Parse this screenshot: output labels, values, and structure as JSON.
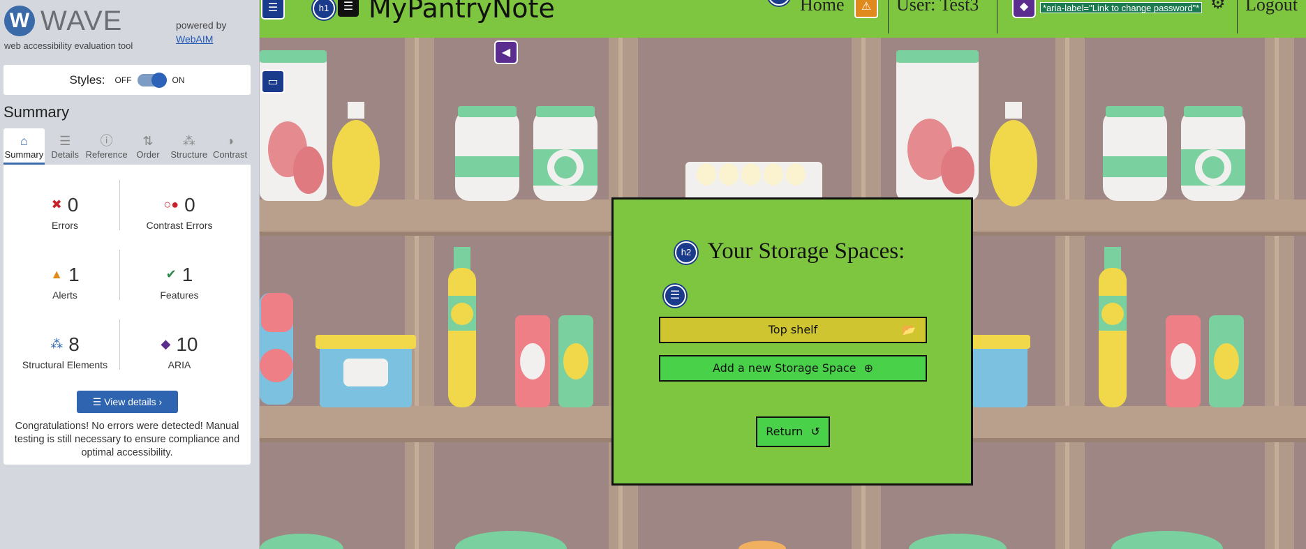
{
  "wave": {
    "logo_letter": "W",
    "logo_text": "WAVE",
    "tagline": "web accessibility evaluation tool",
    "powered_by": "powered by",
    "webaim_link": "WebAIM",
    "styles_label": "Styles:",
    "styles_off": "OFF",
    "styles_on": "ON",
    "summary_title": "Summary",
    "tabs": [
      {
        "label": "Summary",
        "icon": "home-icon",
        "glyph": "⌂",
        "active": true
      },
      {
        "label": "Details",
        "icon": "list-icon",
        "glyph": "☰",
        "active": false
      },
      {
        "label": "Reference",
        "icon": "info-icon",
        "glyph": "ⓘ",
        "active": false
      },
      {
        "label": "Order",
        "icon": "order-icon",
        "glyph": "⇅",
        "active": false
      },
      {
        "label": "Structure",
        "icon": "structure-icon",
        "glyph": "⁂",
        "active": false
      },
      {
        "label": "Contrast",
        "icon": "contrast-icon",
        "glyph": "◑",
        "active": false
      }
    ],
    "stats": {
      "errors": {
        "count": "0",
        "label": "Errors",
        "color": "#c8232c"
      },
      "contrast_errors": {
        "count": "0",
        "label": "Contrast Errors",
        "color": "#c8232c"
      },
      "alerts": {
        "count": "1",
        "label": "Alerts",
        "color": "#e08a1e"
      },
      "features": {
        "count": "1",
        "label": "Features",
        "color": "#2f8a4a"
      },
      "structural": {
        "count": "8",
        "label": "Structural Elements",
        "color": "#2f65b0"
      },
      "aria": {
        "count": "10",
        "label": "ARIA",
        "color": "#5b2d8e"
      }
    },
    "view_details": "View details ›",
    "congrats": "Congratulations! No errors were detected! Manual testing is still necessary to ensure compliance and optimal accessibility."
  },
  "app": {
    "title": "MyPantryNote",
    "nav": {
      "home": "Home",
      "user": "User: Test3",
      "logout": "Logout"
    },
    "aria_label_tag": "*aria-label=\"Link to change password\"*",
    "colors": {
      "header": "#7ec540",
      "shelf_bg": "#9d8683"
    }
  },
  "modal": {
    "heading": "Your Storage Spaces:",
    "top_shelf_button": "Top shelf",
    "add_button": "Add a new Storage Space",
    "return_button": "Return"
  },
  "badges": {
    "h1": "h1",
    "h2": "h2"
  }
}
